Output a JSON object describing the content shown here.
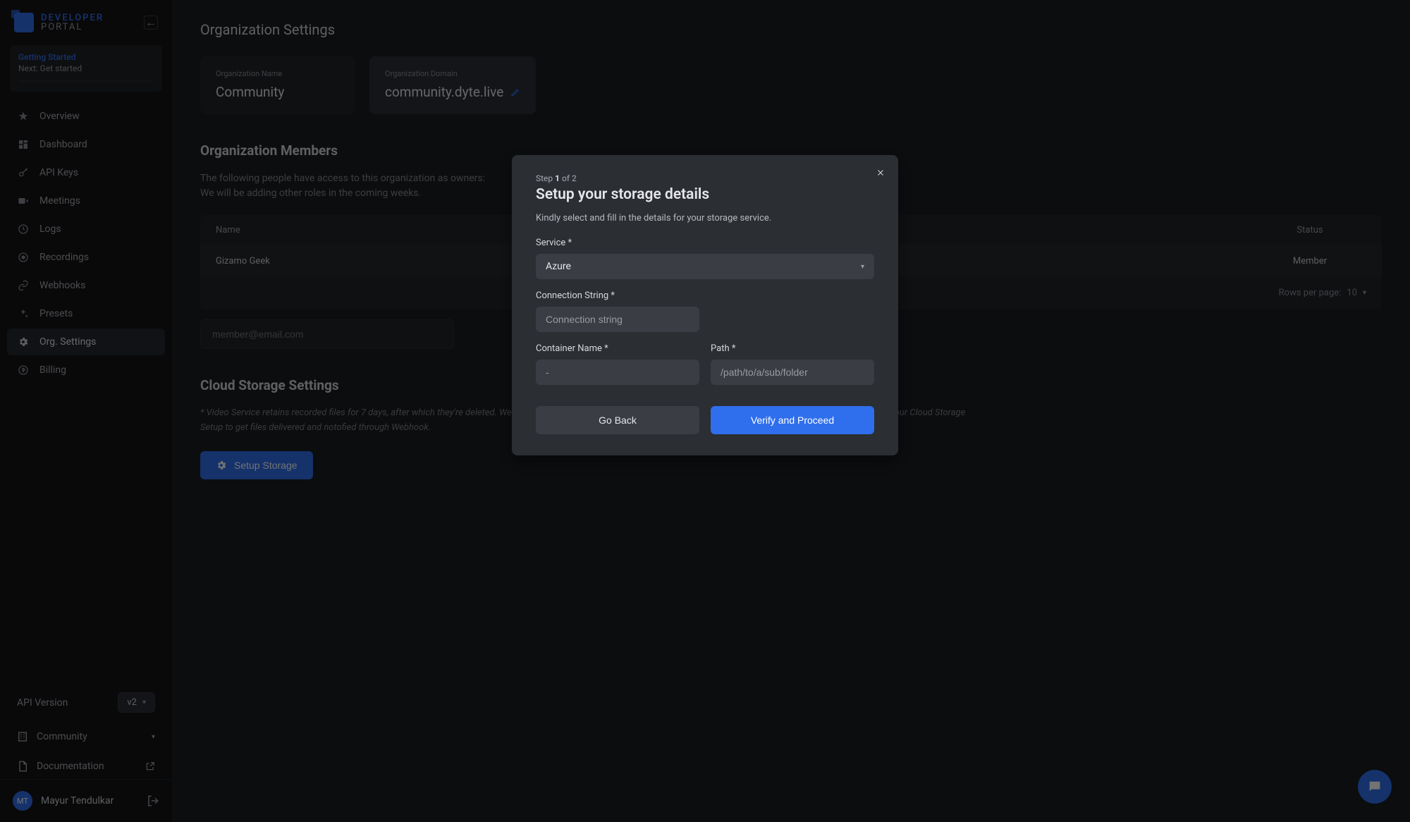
{
  "brand": {
    "t1": "DEVELOPER",
    "t2": "PORTAL"
  },
  "getting_started": {
    "title": "Getting Started",
    "next": "Next: Get started"
  },
  "nav": [
    {
      "label": "Overview",
      "icon": "star-icon"
    },
    {
      "label": "Dashboard",
      "icon": "dashboard-icon"
    },
    {
      "label": "API Keys",
      "icon": "key-icon"
    },
    {
      "label": "Meetings",
      "icon": "video-icon"
    },
    {
      "label": "Logs",
      "icon": "history-icon"
    },
    {
      "label": "Recordings",
      "icon": "record-icon"
    },
    {
      "label": "Webhooks",
      "icon": "link-icon"
    },
    {
      "label": "Presets",
      "icon": "sparkle-icon"
    },
    {
      "label": "Org. Settings",
      "icon": "gear-icon"
    },
    {
      "label": "Billing",
      "icon": "billing-icon"
    }
  ],
  "api_version": {
    "label": "API Version",
    "value": "v2"
  },
  "org_switcher": "Community",
  "doc_link": "Documentation",
  "user": {
    "initials": "MT",
    "name": "Mayur Tendulkar"
  },
  "page": {
    "title": "Organization Settings",
    "org_name_label": "Organization Name",
    "org_name_value": "Community",
    "org_domain_label": "Organization Domain",
    "org_domain_value": "community.dyte.live",
    "members_heading": "Organization Members",
    "members_desc_l1": "The following people have access to this organization as owners:",
    "members_desc_l2": "We will be adding other roles in the coming weeks.",
    "table_head_name": "Name",
    "table_head_status": "Status",
    "table_rows": [
      {
        "name": "Gizamo Geek",
        "status": "Member"
      }
    ],
    "rows_label": "Rows per page:",
    "rows_value": "10",
    "add_member_placeholder": "member@email.com",
    "cs_heading": "Cloud Storage Settings",
    "cs_desc": "* Video Service retains recorded files for 7 days, after which they're deleted. We recommend you save files at your server. You can either pull files yourself from our server or use our Cloud Storage Setup to get files delivered and notofied through Webhook.",
    "setup_btn": "Setup Storage"
  },
  "modal": {
    "step_prefix": "Step ",
    "step_cur": "1",
    "step_of": " of ",
    "step_total": "2",
    "title": "Setup your storage details",
    "desc": "Kindly select and fill in the details for your storage service.",
    "service_label": "Service *",
    "service_value": "Azure",
    "conn_label": "Connection String *",
    "conn_placeholder": "Connection string",
    "container_label": "Container Name *",
    "container_placeholder": "-",
    "path_label": "Path *",
    "path_placeholder": "/path/to/a/sub/folder",
    "back_btn": "Go Back",
    "proceed_btn": "Verify and Proceed"
  }
}
